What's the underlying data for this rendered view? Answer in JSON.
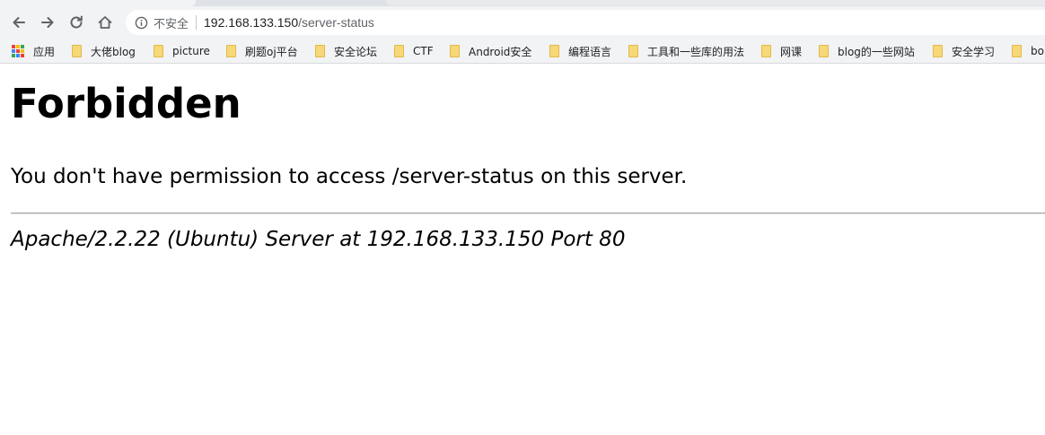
{
  "browser": {
    "security_label": "不安全",
    "url_host": "192.168.133.150",
    "url_path": "/server-status",
    "bookmarks": [
      {
        "label": "应用",
        "icon": "apps-grid-icon"
      },
      {
        "label": "大佬blog",
        "icon": "folder-icon"
      },
      {
        "label": "picture",
        "icon": "folder-icon"
      },
      {
        "label": "刷题oj平台",
        "icon": "folder-icon"
      },
      {
        "label": "安全论坛",
        "icon": "folder-icon"
      },
      {
        "label": "CTF",
        "icon": "folder-icon"
      },
      {
        "label": "Android安全",
        "icon": "folder-icon"
      },
      {
        "label": "编程语言",
        "icon": "folder-icon"
      },
      {
        "label": "工具和一些库的用法",
        "icon": "folder-icon"
      },
      {
        "label": "网课",
        "icon": "folder-icon"
      },
      {
        "label": "blog的一些网站",
        "icon": "folder-icon"
      },
      {
        "label": "安全学习",
        "icon": "folder-icon"
      },
      {
        "label": "bo",
        "icon": "folder-icon"
      }
    ]
  },
  "page": {
    "heading": "Forbidden",
    "message": "You don't have permission to access /server-status on this server.",
    "address": "Apache/2.2.22 (Ubuntu) Server at 192.168.133.150 Port 80"
  },
  "colors": {
    "toolbar_bg": "#f1f3f4",
    "folder": "#f7d878",
    "text": "#000000"
  }
}
